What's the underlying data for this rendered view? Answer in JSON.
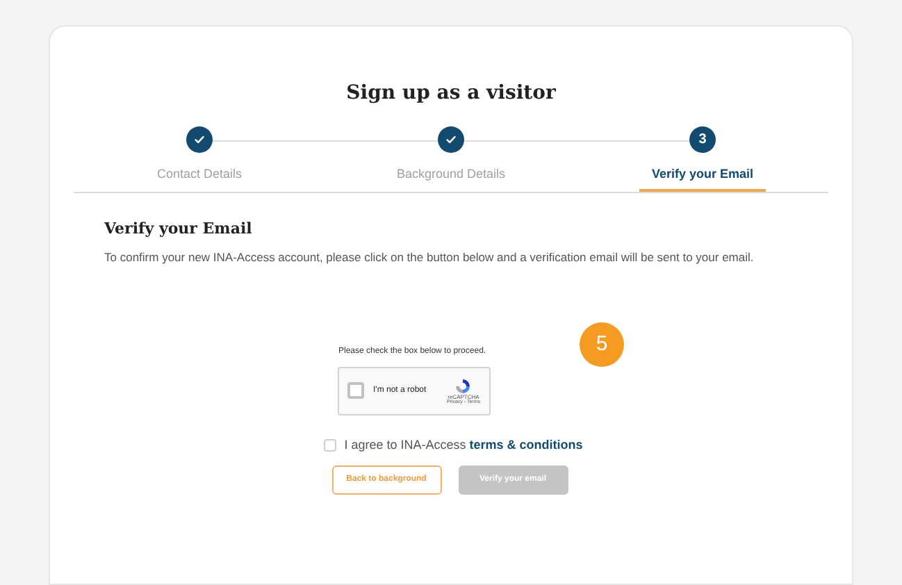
{
  "title": "Sign up as a visitor",
  "steps": [
    {
      "label": "Contact Details",
      "completed": true,
      "selected": false
    },
    {
      "label": "Background Details",
      "completed": true,
      "selected": false
    },
    {
      "label": "Verify your Email",
      "completed": false,
      "number": "3",
      "selected": true
    }
  ],
  "section": {
    "heading": "Verify your Email",
    "text": "To confirm your new INA-Access account, please click on the button below and a verification email will be sent to your email."
  },
  "badge": "5",
  "captcha": {
    "prompt": "Please check the box below to proceed.",
    "label": "I'm not a robot",
    "checked": false,
    "brand": "reCAPTCHA",
    "links": "Privacy - Terms"
  },
  "agree": {
    "text": "I agree to INA-Access",
    "link": "terms & conditions",
    "checked": false
  },
  "buttons": [
    {
      "label": "Back to background",
      "kind": "outline",
      "disabled": false
    },
    {
      "label": "Verify your email",
      "kind": "primary",
      "disabled": true
    }
  ]
}
